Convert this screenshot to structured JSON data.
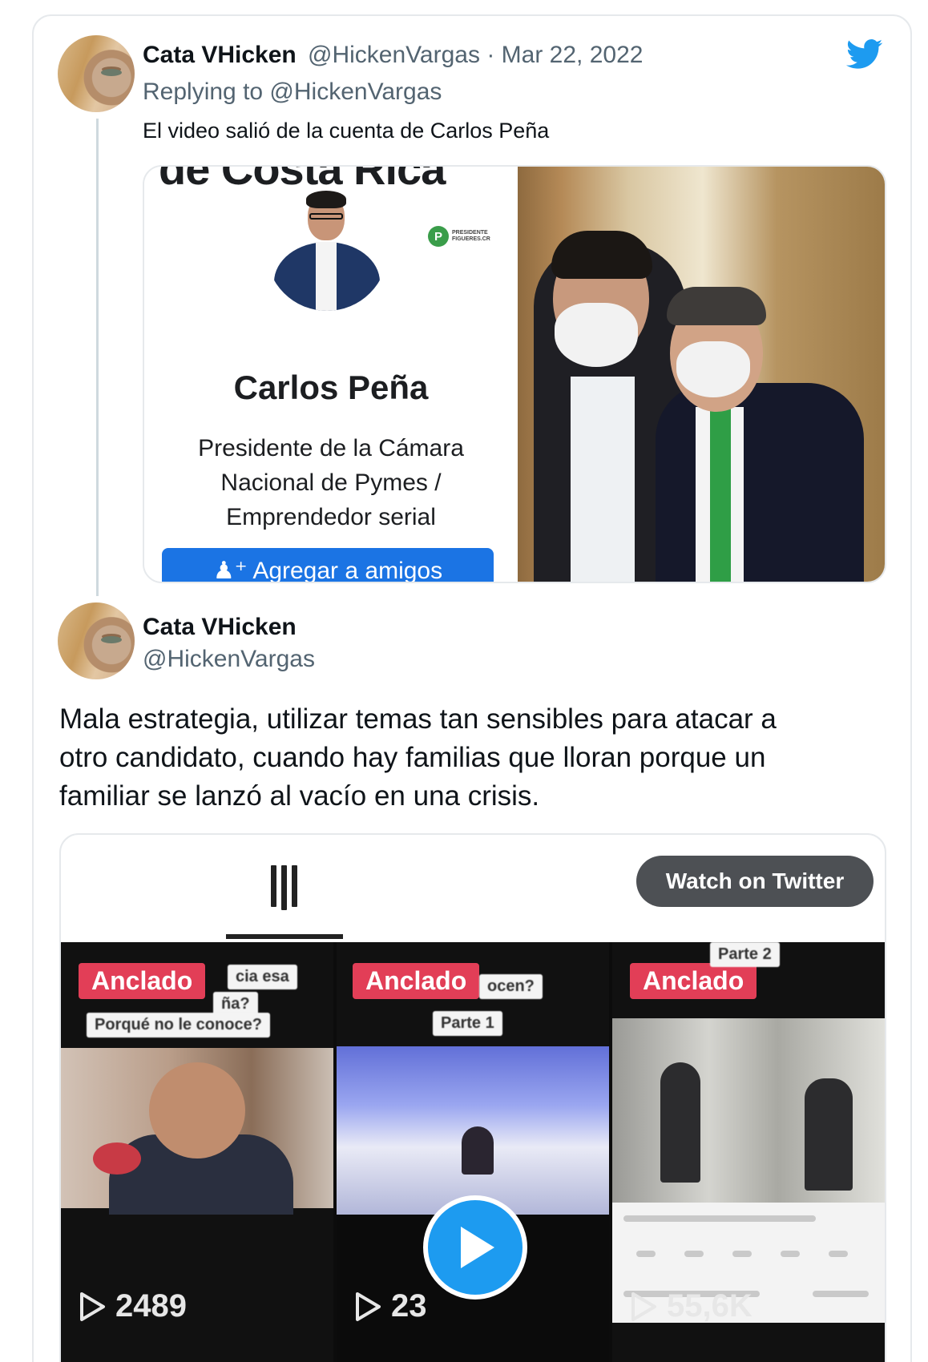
{
  "reply_tweet": {
    "display_name": "Cata VHicken",
    "handle": "@HickenVargas",
    "separator": "·",
    "date": "Mar 22, 2022",
    "replying_to": "Replying to @HickenVargas",
    "text": "El video salió de la cuenta de Carlos Peña",
    "profile_card": {
      "header_text": "de Costa Rica",
      "logo_letter": "P",
      "logo_label_1": "PRESIDENTE",
      "logo_label_2": "FIGUERES.CR",
      "name": "Carlos Peña",
      "bio_line_1": "Presidente de la Cámara",
      "bio_line_2": "Nacional de Pymes /",
      "bio_line_3": "Emprendedor serial",
      "button_label": "Agregar a amigos"
    }
  },
  "main_tweet": {
    "display_name": "Cata VHicken",
    "handle": "@HickenVargas",
    "text_line_1": "Mala estrategia, utilizar temas tan sensibles para atacar a",
    "text_line_2": "otro candidato, cuando hay familias que lloran porque un",
    "text_line_3": "familiar se lanzó al vacío en una crisis.",
    "video": {
      "watch_button_label": "Watch on Twitter",
      "clips": [
        {
          "badge": "Anclado",
          "note_top": "cia esa",
          "note_mid": "ña?",
          "note_bottom": "Porqué no le conoce?",
          "views": "2489"
        },
        {
          "badge": "Anclado",
          "note_top": "ocen?",
          "note_mid": "Parte 1",
          "views": "23"
        },
        {
          "badge": "Anclado",
          "note_top": "Parte 2",
          "views": "55,6K"
        }
      ]
    }
  },
  "icons": {
    "brand": "twitter-bird-icon",
    "video_play": "play-icon"
  },
  "colors": {
    "twitter_blue": "#1d9bf0",
    "facebook_blue": "#1b74e4",
    "badge_red": "#e23e57",
    "secondary_text": "#536471"
  }
}
